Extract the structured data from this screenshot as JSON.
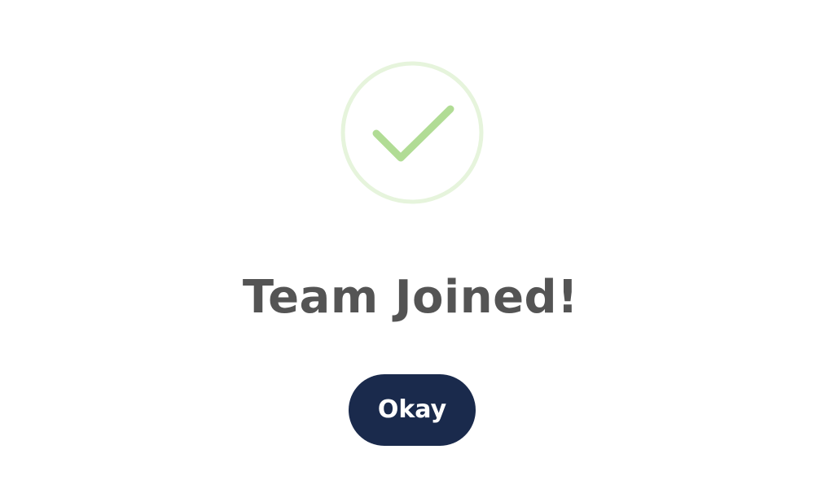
{
  "dialog": {
    "title": "Team Joined!",
    "confirm_label": "Okay"
  },
  "icon": {
    "name": "checkmark-circle-icon"
  },
  "colors": {
    "title_text": "#545454",
    "button_background": "#1a2a4c",
    "button_text": "#ffffff",
    "check_stroke": "#b1dc95",
    "ring_stroke": "#e6f4dc"
  }
}
